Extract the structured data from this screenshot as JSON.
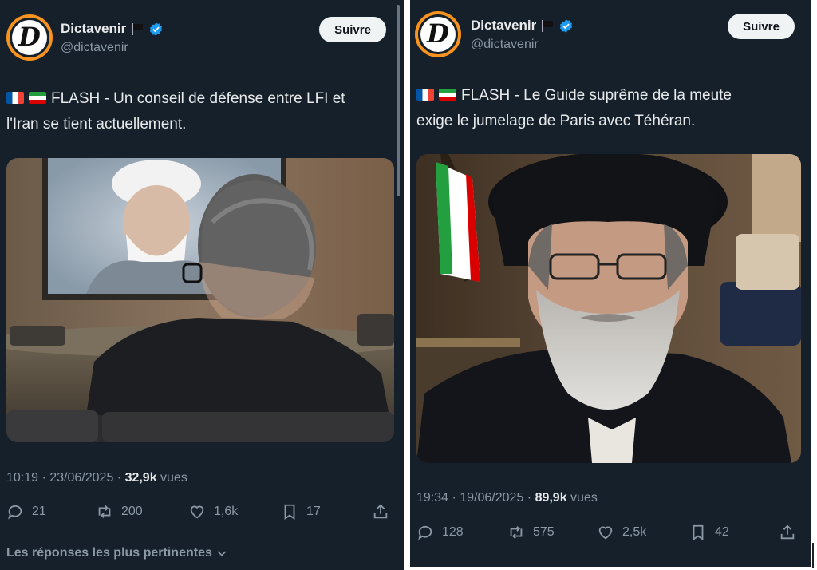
{
  "left": {
    "author": {
      "name": "Dictavenir",
      "handle": "@dictavenir",
      "avatar_letter": "D"
    },
    "follow_label": "Suivre",
    "text_line1": "FLASH - Un conseil de défense entre LFI et",
    "text_line2": "l'Iran se tient actuellement.",
    "time": "10:19 · 23/06/2025 · ",
    "views_count": "32,9k",
    "views_label": " vues",
    "stats": {
      "replies": "21",
      "reposts": "200",
      "likes": "1,6k",
      "bookmarks": "17"
    },
    "replies_sort_label": "Les réponses les plus pertinentes"
  },
  "right": {
    "author": {
      "name": "Dictavenir",
      "handle": "@dictavenir",
      "avatar_letter": "D"
    },
    "follow_label": "Suivre",
    "text_line1": "FLASH - Le Guide suprême de la meute",
    "text_line2": "exige le jumelage de Paris avec Téhéran.",
    "time": "19:34 · 19/06/2025 · ",
    "views_count": "89,9k",
    "views_label": " vues",
    "stats": {
      "replies": "128",
      "reposts": "575",
      "likes": "2,5k",
      "bookmarks": "42"
    }
  },
  "colors": {
    "background": "#15202b",
    "text": "#e7e9ea",
    "muted": "#8b98a5",
    "verified": "#1d9bf0",
    "avatar_ring": "#f7931e"
  },
  "icons": [
    "verified-icon",
    "reply-icon",
    "repost-icon",
    "like-icon",
    "bookmark-icon",
    "share-icon",
    "chevron-down-icon"
  ]
}
